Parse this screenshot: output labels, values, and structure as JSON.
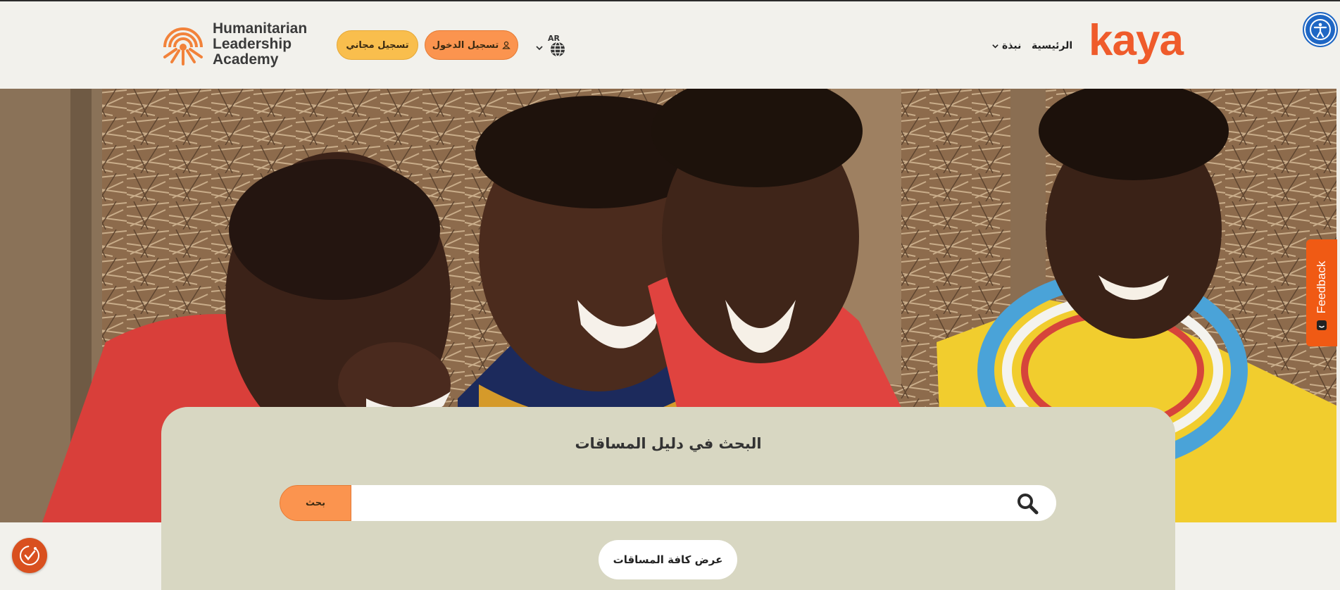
{
  "header": {
    "hla_logo": {
      "line1": "Humanitarian",
      "line2": "Leadership",
      "line3": "Academy"
    },
    "signup_label": "تسجيل مجاني",
    "login_label": "تسجيل الدخول",
    "language": {
      "code": "AR"
    },
    "nav": {
      "home_label": "الرئيسية",
      "about_label": "نبذة"
    },
    "brand": "kaya"
  },
  "feedback": {
    "label": "Feedback"
  },
  "search_panel": {
    "title": "البحث في دليل المساقات",
    "search_button_label": "بحث",
    "search_value": "",
    "view_all_label": "عرض كافة المساقات"
  },
  "colors": {
    "brand_orange": "#ef5b2b",
    "login_button": "#fb944f",
    "signup_button": "#f9be4d",
    "panel_bg": "#d8d7c2",
    "accessibility_blue": "#1f67c4",
    "feedback_tab": "#f05a14"
  },
  "icons": {
    "accessibility": "accessibility-icon",
    "globe": "globe-icon",
    "user": "user-icon",
    "search": "search-icon",
    "cookie": "cookie-consent-icon",
    "feedback": "smile-icon"
  }
}
